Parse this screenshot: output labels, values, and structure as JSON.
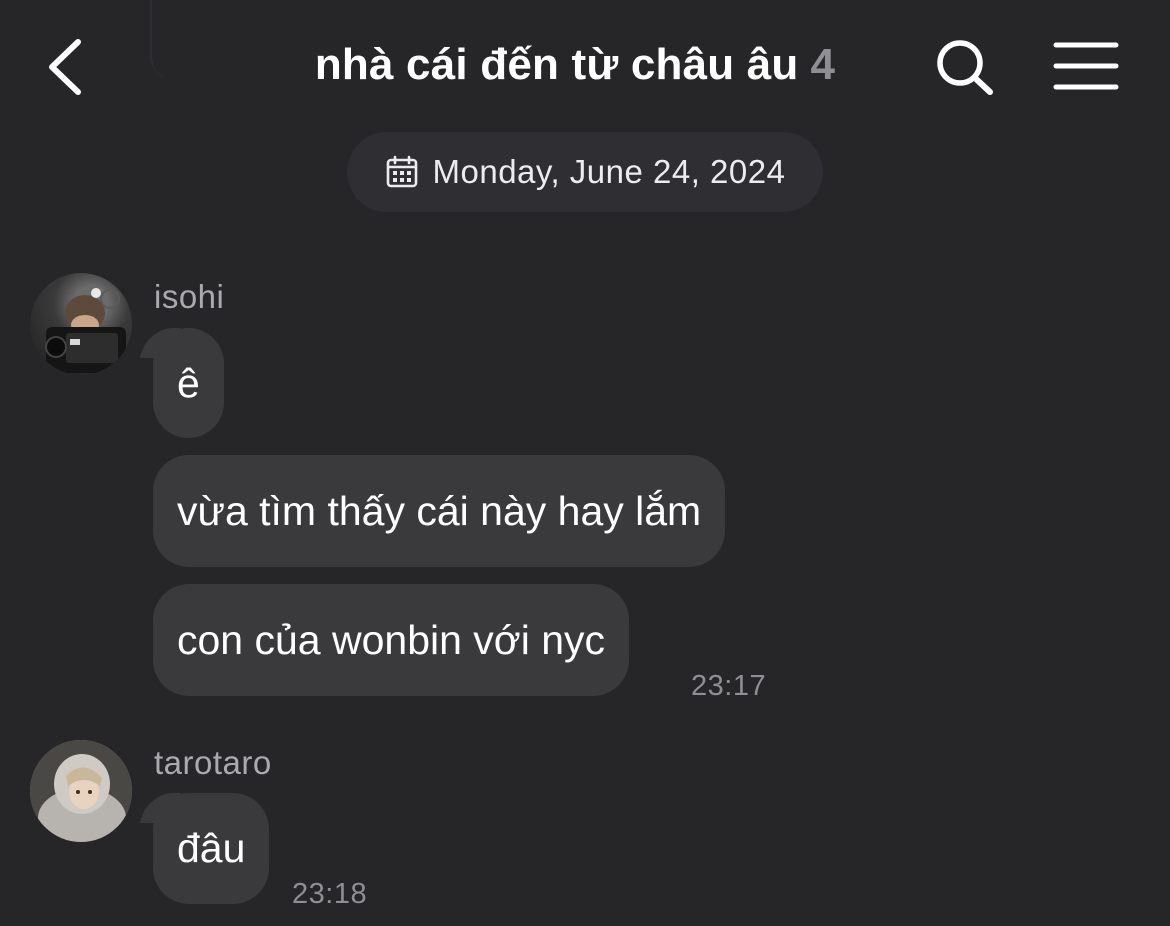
{
  "header": {
    "back_icon": "chevron-left-icon",
    "title": "nhà cái đến từ châu âu",
    "member_count": "4",
    "search_icon": "search-icon",
    "menu_icon": "hamburger-menu-icon"
  },
  "date_divider": {
    "icon": "calendar-icon",
    "text": "Monday, June 24, 2024"
  },
  "messages": [
    {
      "sender": "isohi",
      "bubbles": [
        "ê",
        "vừa tìm thấy cái này hay lắm",
        "con của wonbin với nyc"
      ],
      "time": "23:17"
    },
    {
      "sender": "tarotaro",
      "bubbles": [
        "đâu"
      ],
      "time": "23:18"
    }
  ],
  "colors": {
    "background": "#262629",
    "bubble": "#3a3a3d",
    "date_pill": "#2f2f33",
    "muted_text": "#8e8e93"
  }
}
